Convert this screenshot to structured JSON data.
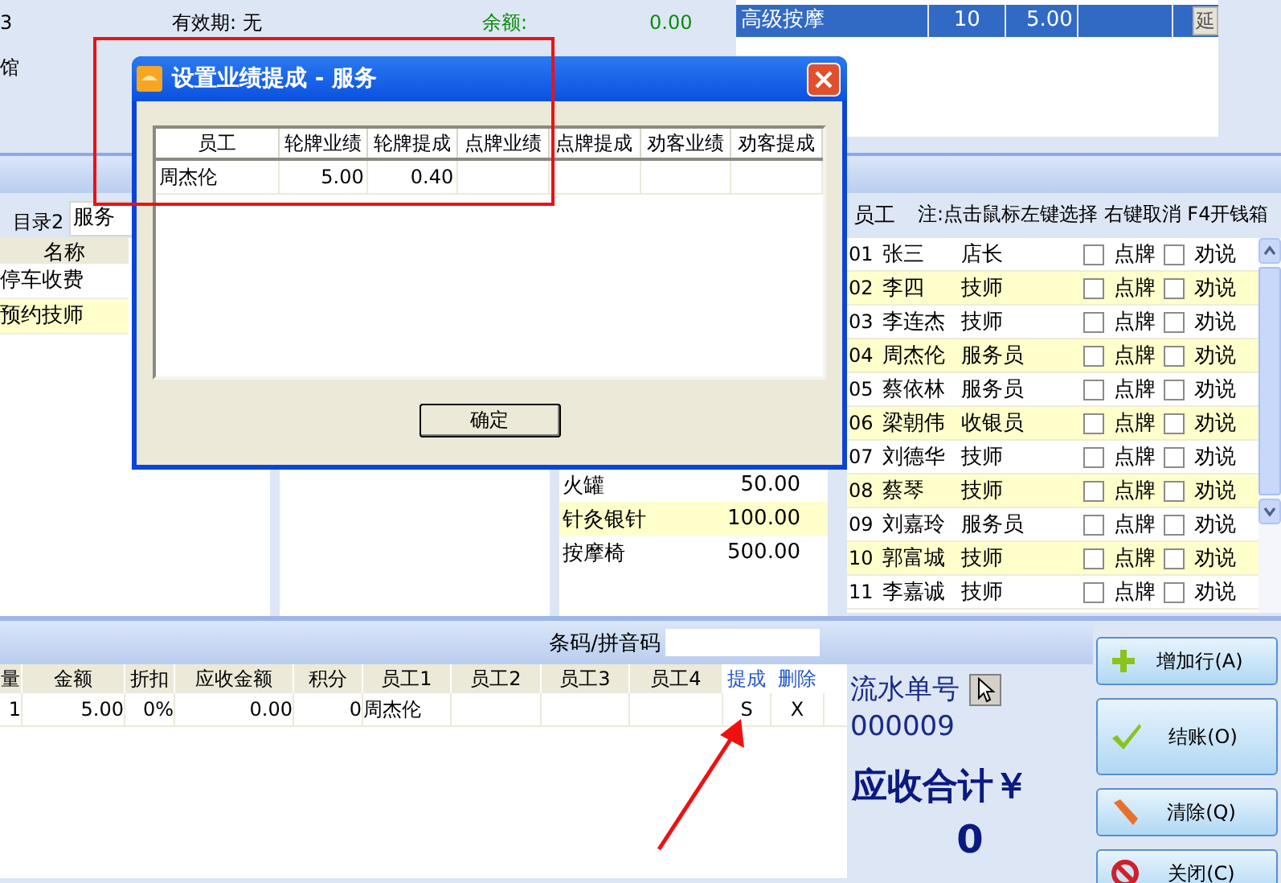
{
  "header": {
    "card_no": "3",
    "shop": "馆",
    "validity_label": "有效期:",
    "validity": "无",
    "balance_label": "余额:",
    "balance": "0.00"
  },
  "selected_items": {
    "rows": [
      {
        "cells": [
          "高级按摩",
          "10",
          "5.00",
          ""
        ],
        "selected": true,
        "action": "延"
      }
    ]
  },
  "category": {
    "label": "目录2",
    "value": "服务"
  },
  "item_list": {
    "header": "名称",
    "rows": [
      {
        "name": "停车收费"
      },
      {
        "name": "预约技师"
      }
    ]
  },
  "price_list": {
    "rows": [
      {
        "name": "火罐",
        "price": "50.00"
      },
      {
        "name": "针灸银针",
        "price": "100.00"
      },
      {
        "name": "按摩椅",
        "price": "500.00"
      }
    ]
  },
  "staff": {
    "title": "员工",
    "note": "注:点击鼠标左键选择 右键取消 F4开钱箱",
    "rows": [
      {
        "no": "01",
        "name": "张三",
        "role": "店长",
        "point": {
          "label": "点牌",
          "checked": false
        },
        "persuade": {
          "label": "劝说",
          "checked": false
        }
      },
      {
        "no": "02",
        "name": "李四",
        "role": "技师",
        "point": {
          "label": "点牌",
          "checked": false
        },
        "persuade": {
          "label": "劝说",
          "checked": false
        }
      },
      {
        "no": "03",
        "name": "李连杰",
        "role": "技师",
        "point": {
          "label": "点牌",
          "checked": false
        },
        "persuade": {
          "label": "劝说",
          "checked": false
        }
      },
      {
        "no": "04",
        "name": "周杰伦",
        "role": "服务员",
        "point": {
          "label": "点牌",
          "checked": false
        },
        "persuade": {
          "label": "劝说",
          "checked": false
        }
      },
      {
        "no": "05",
        "name": "蔡依林",
        "role": "服务员",
        "point": {
          "label": "点牌",
          "checked": false
        },
        "persuade": {
          "label": "劝说",
          "checked": false
        }
      },
      {
        "no": "06",
        "name": "梁朝伟",
        "role": "收银员",
        "point": {
          "label": "点牌",
          "checked": false
        },
        "persuade": {
          "label": "劝说",
          "checked": false
        }
      },
      {
        "no": "07",
        "name": "刘德华",
        "role": "技师",
        "point": {
          "label": "点牌",
          "checked": false
        },
        "persuade": {
          "label": "劝说",
          "checked": false
        }
      },
      {
        "no": "08",
        "name": "蔡琴",
        "role": "技师",
        "point": {
          "label": "点牌",
          "checked": false
        },
        "persuade": {
          "label": "劝说",
          "checked": false
        }
      },
      {
        "no": "09",
        "name": "刘嘉玲",
        "role": "服务员",
        "point": {
          "label": "点牌",
          "checked": false
        },
        "persuade": {
          "label": "劝说",
          "checked": false
        }
      },
      {
        "no": "10",
        "name": "郭富城",
        "role": "技师",
        "point": {
          "label": "点牌",
          "checked": false
        },
        "persuade": {
          "label": "劝说",
          "checked": false
        }
      },
      {
        "no": "11",
        "name": "李嘉诚",
        "role": "技师",
        "point": {
          "label": "点牌",
          "checked": false
        },
        "persuade": {
          "label": "劝说",
          "checked": false
        }
      }
    ]
  },
  "barcode": {
    "label": "条码/拼音码"
  },
  "order": {
    "columns": [
      {
        "label": "量",
        "kind": "text"
      },
      {
        "label": "金额",
        "kind": "text"
      },
      {
        "label": "折扣",
        "kind": "text"
      },
      {
        "label": "应收金额",
        "kind": "text"
      },
      {
        "label": "积分",
        "kind": "text"
      },
      {
        "label": "员工1",
        "kind": "text"
      },
      {
        "label": "员工2",
        "kind": "text"
      },
      {
        "label": "员工3",
        "kind": "text"
      },
      {
        "label": "员工4",
        "kind": "text"
      },
      {
        "label": "提成",
        "kind": "link"
      },
      {
        "label": "删除",
        "kind": "link"
      }
    ],
    "rows": [
      {
        "cells": [
          "1",
          "5.00",
          "0%",
          "0.00",
          "0",
          "周杰伦",
          "",
          "",
          "",
          "S",
          "X"
        ]
      }
    ]
  },
  "summary": {
    "serial_label": "流水单号",
    "serial": "000009",
    "total_label": "应收合计￥",
    "total": "0"
  },
  "buttons": [
    {
      "label": "增加行(A)",
      "kind": "plus"
    },
    {
      "label": "结账(O)",
      "kind": "check"
    },
    {
      "label": "清除(Q)",
      "kind": "eraser"
    },
    {
      "label": "关闭(C)",
      "kind": "stop"
    }
  ],
  "dialog": {
    "title": "设置业绩提成 - 服务",
    "columns": [
      "员工",
      "轮牌业绩",
      "轮牌提成",
      "点牌业绩",
      "点牌提成",
      "劝客业绩",
      "劝客提成"
    ],
    "rows": [
      {
        "cells": [
          "周杰伦",
          "5.00",
          "0.40",
          "",
          "",
          "",
          ""
        ]
      }
    ],
    "ok": "确定"
  }
}
